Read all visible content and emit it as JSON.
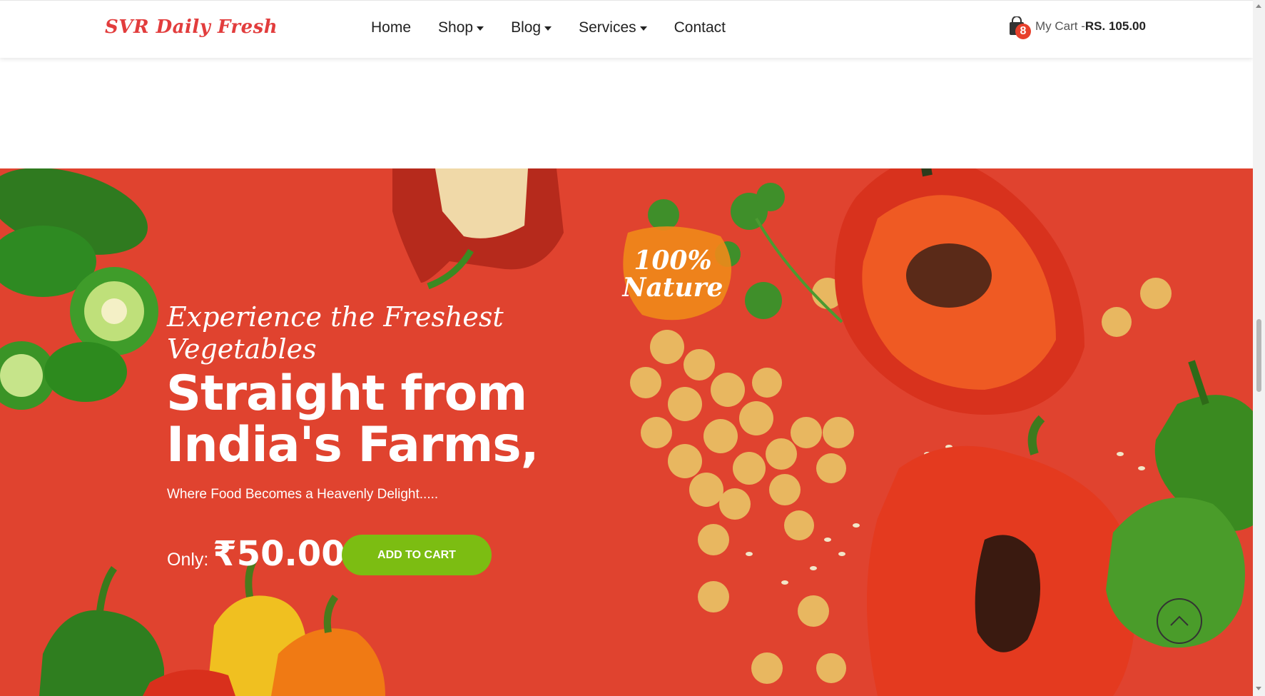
{
  "brand": {
    "logo_text": "SVR Daily Fresh",
    "accent_color": "#e0432f",
    "button_color": "#7cbd12"
  },
  "nav": {
    "items": [
      {
        "label": "Home",
        "has_dropdown": false
      },
      {
        "label": "Shop",
        "has_dropdown": true
      },
      {
        "label": "Blog",
        "has_dropdown": true
      },
      {
        "label": "Services",
        "has_dropdown": true
      },
      {
        "label": "Contact",
        "has_dropdown": false
      }
    ]
  },
  "cart": {
    "icon": "shopping-bag-icon",
    "count": "8",
    "label": "My Cart -",
    "total": "RS. 105.00"
  },
  "hero": {
    "subtitle": "Experience the Freshest Vegetables",
    "title_line1": "Straight from",
    "title_line2": "India's Farms,",
    "tagline": "Where Food Becomes a Heavenly Delight.....",
    "price_label": "Only:",
    "price_value": "₹50.00",
    "cta_label": "ADD TO CART",
    "badge_line1": "100%",
    "badge_line2": "Nature"
  },
  "scroll_top_icon": "chevron-up-icon"
}
